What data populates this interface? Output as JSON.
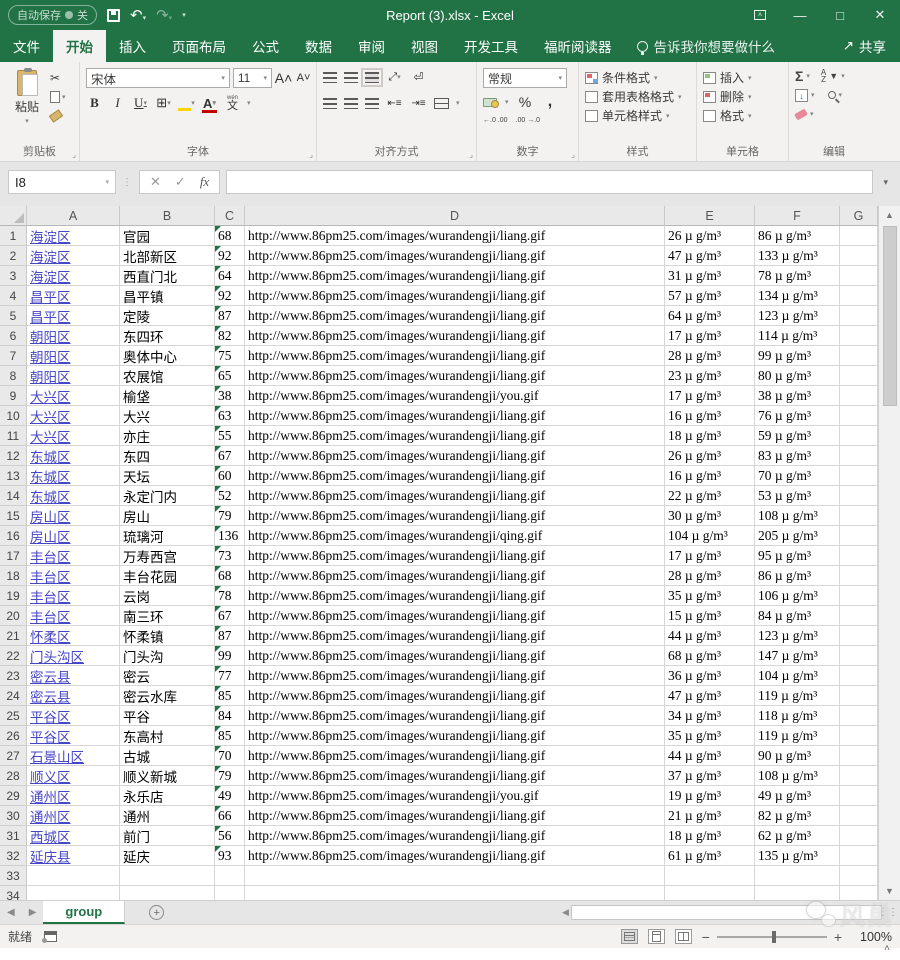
{
  "title_bar": {
    "autosave_label": "自动保存",
    "autosave_state": "关",
    "title": "Report (3).xlsx - Excel"
  },
  "ribbon": {
    "tabs": [
      {
        "label": "文件",
        "active": false
      },
      {
        "label": "开始",
        "active": true
      },
      {
        "label": "插入",
        "active": false
      },
      {
        "label": "页面布局",
        "active": false
      },
      {
        "label": "公式",
        "active": false
      },
      {
        "label": "数据",
        "active": false
      },
      {
        "label": "审阅",
        "active": false
      },
      {
        "label": "视图",
        "active": false
      },
      {
        "label": "开发工具",
        "active": false
      },
      {
        "label": "福昕阅读器",
        "active": false
      }
    ],
    "tell_me": "告诉我你想要做什么",
    "share_label": "共享",
    "clipboard": {
      "group_label": "剪贴板",
      "paste_label": "粘贴"
    },
    "font": {
      "group_label": "字体",
      "font_name": "宋体",
      "font_size": "11",
      "bold": "B",
      "italic": "I",
      "underline": "U",
      "pinyin_top": "wén",
      "pinyin_char": "文"
    },
    "alignment": {
      "group_label": "对齐方式"
    },
    "number": {
      "group_label": "数字",
      "format": "常规",
      "decimal_inc": "←.0 .00",
      "decimal_dec": ".00 →.0"
    },
    "styles": {
      "group_label": "样式",
      "items": [
        "条件格式",
        "套用表格格式",
        "单元格样式"
      ]
    },
    "cells": {
      "group_label": "单元格",
      "items": [
        "插入",
        "删除",
        "格式"
      ]
    },
    "editing": {
      "group_label": "编辑",
      "autosum": "Σ"
    }
  },
  "formula_bar": {
    "name_box": "I8",
    "formula": ""
  },
  "grid": {
    "columns": [
      "A",
      "B",
      "C",
      "D",
      "E",
      "F",
      "G"
    ],
    "unit": "µ g/m³",
    "rows": [
      {
        "n": 1,
        "district": "海淀区",
        "station": "官园",
        "c": "68",
        "url": "http://www.86pm25.com/images/wurandengji/liang.gif",
        "e": "26",
        "f": "86"
      },
      {
        "n": 2,
        "district": "海淀区",
        "station": "北部新区",
        "c": "92",
        "url": "http://www.86pm25.com/images/wurandengji/liang.gif",
        "e": "47",
        "f": "133"
      },
      {
        "n": 3,
        "district": "海淀区",
        "station": "西直门北",
        "c": "64",
        "url": "http://www.86pm25.com/images/wurandengji/liang.gif",
        "e": "31",
        "f": "78"
      },
      {
        "n": 4,
        "district": "昌平区",
        "station": "昌平镇",
        "c": "92",
        "url": "http://www.86pm25.com/images/wurandengji/liang.gif",
        "e": "57",
        "f": "134"
      },
      {
        "n": 5,
        "district": "昌平区",
        "station": "定陵",
        "c": "87",
        "url": "http://www.86pm25.com/images/wurandengji/liang.gif",
        "e": "64",
        "f": "123"
      },
      {
        "n": 6,
        "district": "朝阳区",
        "station": "东四环",
        "c": "82",
        "url": "http://www.86pm25.com/images/wurandengji/liang.gif",
        "e": "17",
        "f": "114"
      },
      {
        "n": 7,
        "district": "朝阳区",
        "station": "奥体中心",
        "c": "75",
        "url": "http://www.86pm25.com/images/wurandengji/liang.gif",
        "e": "28",
        "f": "99"
      },
      {
        "n": 8,
        "district": "朝阳区",
        "station": "农展馆",
        "c": "65",
        "url": "http://www.86pm25.com/images/wurandengji/liang.gif",
        "e": "23",
        "f": "80"
      },
      {
        "n": 9,
        "district": "大兴区",
        "station": "榆垡",
        "c": "38",
        "url": "http://www.86pm25.com/images/wurandengji/you.gif",
        "e": "17",
        "f": "38"
      },
      {
        "n": 10,
        "district": "大兴区",
        "station": "大兴",
        "c": "63",
        "url": "http://www.86pm25.com/images/wurandengji/liang.gif",
        "e": "16",
        "f": "76"
      },
      {
        "n": 11,
        "district": "大兴区",
        "station": "亦庄",
        "c": "55",
        "url": "http://www.86pm25.com/images/wurandengji/liang.gif",
        "e": "18",
        "f": "59"
      },
      {
        "n": 12,
        "district": "东城区",
        "station": "东四",
        "c": "67",
        "url": "http://www.86pm25.com/images/wurandengji/liang.gif",
        "e": "26",
        "f": "83"
      },
      {
        "n": 13,
        "district": "东城区",
        "station": "天坛",
        "c": "60",
        "url": "http://www.86pm25.com/images/wurandengji/liang.gif",
        "e": "16",
        "f": "70"
      },
      {
        "n": 14,
        "district": "东城区",
        "station": "永定门内",
        "c": "52",
        "url": "http://www.86pm25.com/images/wurandengji/liang.gif",
        "e": "22",
        "f": "53"
      },
      {
        "n": 15,
        "district": "房山区",
        "station": "房山",
        "c": "79",
        "url": "http://www.86pm25.com/images/wurandengji/liang.gif",
        "e": "30",
        "f": "108"
      },
      {
        "n": 16,
        "district": "房山区",
        "station": "琉璃河",
        "c": "136",
        "url": "http://www.86pm25.com/images/wurandengji/qing.gif",
        "e": "104",
        "f": "205"
      },
      {
        "n": 17,
        "district": "丰台区",
        "station": "万寿西宫",
        "c": "73",
        "url": "http://www.86pm25.com/images/wurandengji/liang.gif",
        "e": "17",
        "f": "95"
      },
      {
        "n": 18,
        "district": "丰台区",
        "station": "丰台花园",
        "c": "68",
        "url": "http://www.86pm25.com/images/wurandengji/liang.gif",
        "e": "28",
        "f": "86"
      },
      {
        "n": 19,
        "district": "丰台区",
        "station": "云岗",
        "c": "78",
        "url": "http://www.86pm25.com/images/wurandengji/liang.gif",
        "e": "35",
        "f": "106"
      },
      {
        "n": 20,
        "district": "丰台区",
        "station": "南三环",
        "c": "67",
        "url": "http://www.86pm25.com/images/wurandengji/liang.gif",
        "e": "15",
        "f": "84"
      },
      {
        "n": 21,
        "district": "怀柔区",
        "station": "怀柔镇",
        "c": "87",
        "url": "http://www.86pm25.com/images/wurandengji/liang.gif",
        "e": "44",
        "f": "123"
      },
      {
        "n": 22,
        "district": "门头沟区",
        "station": "门头沟",
        "c": "99",
        "url": "http://www.86pm25.com/images/wurandengji/liang.gif",
        "e": "68",
        "f": "147"
      },
      {
        "n": 23,
        "district": "密云县",
        "station": "密云",
        "c": "77",
        "url": "http://www.86pm25.com/images/wurandengji/liang.gif",
        "e": "36",
        "f": "104"
      },
      {
        "n": 24,
        "district": "密云县",
        "station": "密云水库",
        "c": "85",
        "url": "http://www.86pm25.com/images/wurandengji/liang.gif",
        "e": "47",
        "f": "119"
      },
      {
        "n": 25,
        "district": "平谷区",
        "station": "平谷",
        "c": "84",
        "url": "http://www.86pm25.com/images/wurandengji/liang.gif",
        "e": "34",
        "f": "118"
      },
      {
        "n": 26,
        "district": "平谷区",
        "station": "东高村",
        "c": "85",
        "url": "http://www.86pm25.com/images/wurandengji/liang.gif",
        "e": "35",
        "f": "119"
      },
      {
        "n": 27,
        "district": "石景山区",
        "station": "古城",
        "c": "70",
        "url": "http://www.86pm25.com/images/wurandengji/liang.gif",
        "e": "44",
        "f": "90"
      },
      {
        "n": 28,
        "district": "顺义区",
        "station": "顺义新城",
        "c": "79",
        "url": "http://www.86pm25.com/images/wurandengji/liang.gif",
        "e": "37",
        "f": "108"
      },
      {
        "n": 29,
        "district": "通州区",
        "station": "永乐店",
        "c": "49",
        "url": "http://www.86pm25.com/images/wurandengji/you.gif",
        "e": "19",
        "f": "49"
      },
      {
        "n": 30,
        "district": "通州区",
        "station": "通州",
        "c": "66",
        "url": "http://www.86pm25.com/images/wurandengji/liang.gif",
        "e": "21",
        "f": "82"
      },
      {
        "n": 31,
        "district": "西城区",
        "station": "前门",
        "c": "56",
        "url": "http://www.86pm25.com/images/wurandengji/liang.gif",
        "e": "18",
        "f": "62"
      },
      {
        "n": 32,
        "district": "延庆县",
        "station": "延庆",
        "c": "93",
        "url": "http://www.86pm25.com/images/wurandengji/liang.gif",
        "e": "61",
        "f": "135"
      },
      {
        "n": 33,
        "district": "",
        "station": "",
        "c": "",
        "url": "",
        "e": "",
        "f": ""
      },
      {
        "n": 34,
        "district": "",
        "station": "",
        "c": "",
        "url": "",
        "e": "",
        "f": ""
      }
    ]
  },
  "sheet_bar": {
    "active_tab": "group"
  },
  "status_bar": {
    "status": "就绪",
    "zoom": "100%"
  },
  "watermark": {
    "text": "风巢"
  }
}
